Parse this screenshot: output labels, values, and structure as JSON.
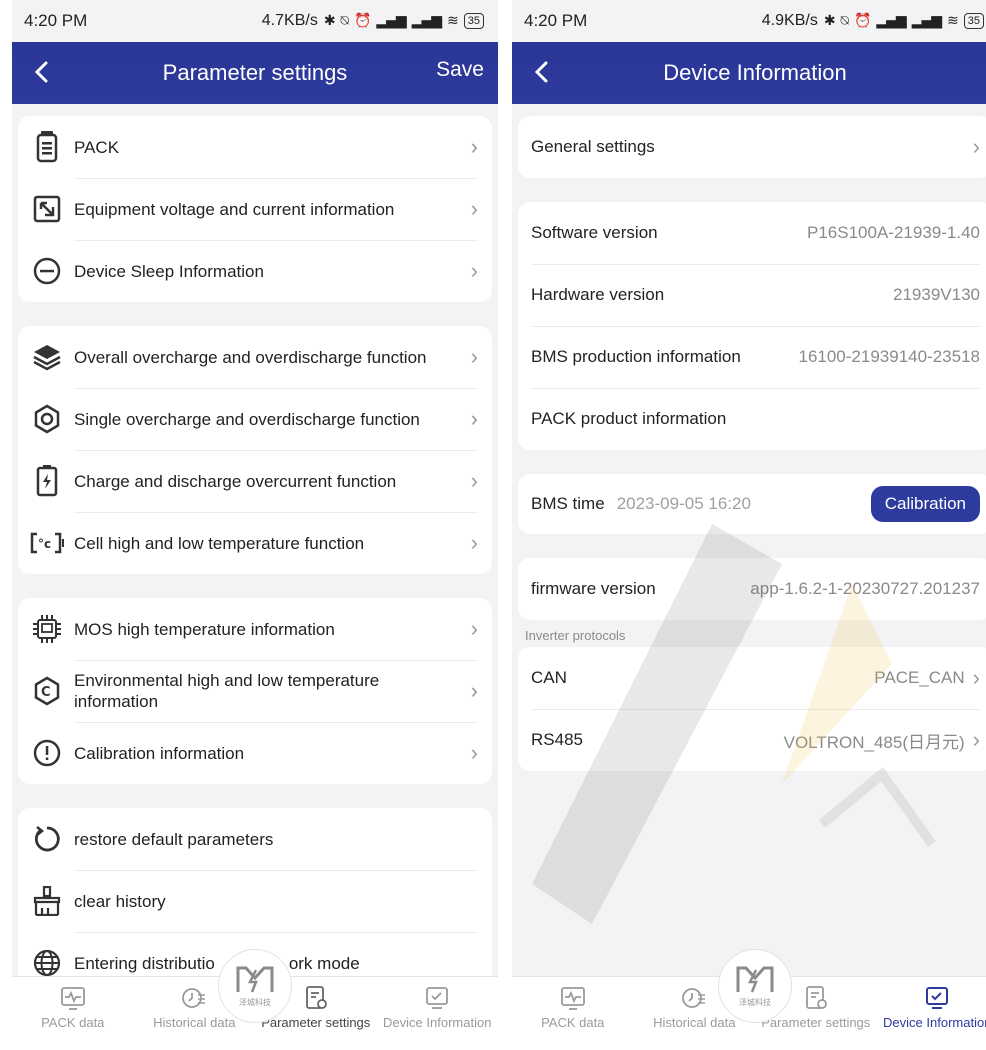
{
  "colors": {
    "nav": "#2d3a9e",
    "accent": "#2d3a9e",
    "page_bg": "#f3f3f5"
  },
  "left": {
    "status": {
      "time": "4:20 PM",
      "speed": "4.7KB/s",
      "battery": "35"
    },
    "nav": {
      "title": "Parameter settings",
      "save": "Save"
    },
    "groups": [
      [
        {
          "icon": "battery-icon",
          "label": "PACK"
        },
        {
          "icon": "voltage-icon",
          "label": "Equipment voltage and current information"
        },
        {
          "icon": "sleep-icon",
          "label": "Device Sleep Information"
        }
      ],
      [
        {
          "icon": "layers-icon",
          "label": "Overall overcharge and overdischarge function"
        },
        {
          "icon": "hexagon-icon",
          "label": "Single overcharge and overdischarge function"
        },
        {
          "icon": "charge-icon",
          "label": "Charge and discharge overcurrent function"
        },
        {
          "icon": "temperature-icon",
          "label": "Cell high and low temperature function"
        }
      ],
      [
        {
          "icon": "chip-icon",
          "label": "MOS high temperature information"
        },
        {
          "icon": "env-temperature-icon",
          "label": "Environmental high and low temperature information"
        },
        {
          "icon": "alert-icon",
          "label": "Calibration information"
        }
      ],
      [
        {
          "icon": "restore-icon",
          "label": "restore default parameters"
        },
        {
          "icon": "broom-icon",
          "label": "clear history"
        },
        {
          "icon": "globe-icon",
          "label": "Entering distributio",
          "label_tail": "ork mode"
        }
      ]
    ],
    "tabs": [
      "PACK data",
      "Historical data",
      "Parameter settings",
      "Device Information"
    ],
    "active_tab": 2
  },
  "right": {
    "status": {
      "time": "4:20 PM",
      "speed": "4.9KB/s",
      "battery": "35"
    },
    "nav": {
      "title": "Device Information"
    },
    "general": {
      "label": "General settings"
    },
    "versions": [
      {
        "label": "Software version",
        "value": "P16S100A-21939-1.40"
      },
      {
        "label": "Hardware version",
        "value": "21939V130"
      },
      {
        "label": "BMS production information",
        "value": "16100-21939140-23518"
      },
      {
        "label": "PACK product information",
        "value": ""
      }
    ],
    "bms_time": {
      "label": "BMS time",
      "value": "2023-09-05 16:20",
      "button": "Calibration"
    },
    "firmware": {
      "label": "firmware version",
      "value": "app-1.6.2-1-20230727.201237"
    },
    "inverter_caption": "Inverter protocols",
    "protocols": [
      {
        "label": "CAN",
        "value": "PACE_CAN"
      },
      {
        "label": "RS485",
        "value": "VOLTRON_485(日月元)"
      }
    ],
    "tabs": [
      "PACK data",
      "Historical data",
      "Parameter settings",
      "Device Information"
    ],
    "active_tab": 3
  },
  "logo_text": "泽城科技"
}
